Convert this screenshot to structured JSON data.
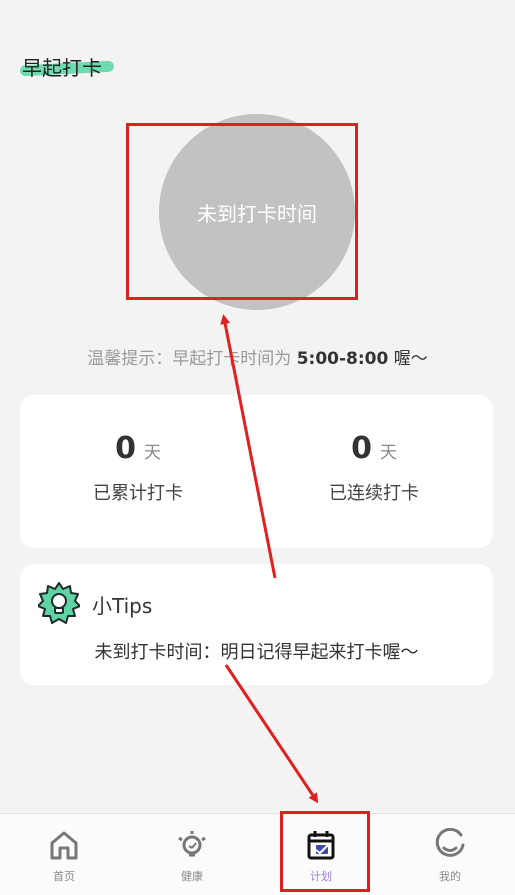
{
  "header": {
    "title": "早起打卡"
  },
  "checkin": {
    "button_label": "未到打卡时间"
  },
  "hint": {
    "prefix": "温馨提示：早起打卡时间为",
    "time_range": "5:00-8:00",
    "suffix": "喔～"
  },
  "stats": [
    {
      "value": "0",
      "unit": "天",
      "label": "已累计打卡"
    },
    {
      "value": "0",
      "unit": "天",
      "label": "已连续打卡"
    }
  ],
  "tips": {
    "title": "小Tips",
    "body": "未到打卡时间：明日记得早起来打卡喔～"
  },
  "tabbar": {
    "items": [
      {
        "label": "首页",
        "icon": "home-icon"
      },
      {
        "label": "健康",
        "icon": "lightbulb-icon"
      },
      {
        "label": "计划",
        "icon": "calendar-check-icon",
        "active": true
      },
      {
        "label": "我的",
        "icon": "smile-icon"
      }
    ]
  },
  "colors": {
    "accent_green": "#6fdcb0",
    "active_tab": "#9b7de0",
    "annotation_red": "#e02020",
    "circle_gray": "#c2c2c2"
  }
}
